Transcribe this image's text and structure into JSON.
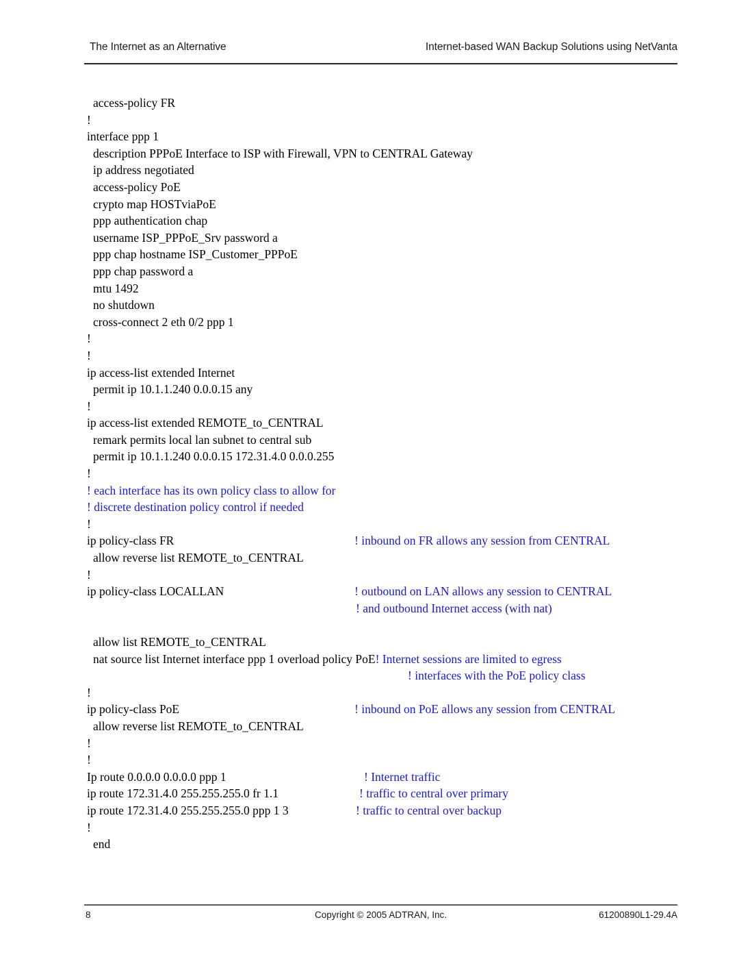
{
  "header": {
    "left": "The Internet as an Alternative",
    "right": "Internet-based WAN Backup Solutions using NetVanta"
  },
  "colors": {
    "comment_blue": "#1a1ad6",
    "text_black": "#000000",
    "rule_dark": "#262626",
    "rule_gray": "#5c5c5c"
  },
  "config": {
    "lines": [
      {
        "text": "access-policy FR"
      },
      {
        "text": "!"
      },
      {
        "text": "interface ppp 1"
      },
      {
        "text": "description PPPoE Interface to ISP with Firewall, VPN to CENTRAL Gateway"
      },
      {
        "text": "ip address negotiated"
      },
      {
        "text": "access-policy PoE"
      },
      {
        "text": "crypto map HOSTviaPoE"
      },
      {
        "text": "ppp authentication chap"
      },
      {
        "text": "username ISP_PPPoE_Srv password a"
      },
      {
        "text": "ppp chap hostname ISP_Customer_PPPoE"
      },
      {
        "text": "ppp chap password a"
      },
      {
        "text": "mtu 1492"
      },
      {
        "text": "no shutdown"
      },
      {
        "text": "cross-connect 2 eth 0/2 ppp 1"
      },
      {
        "text": "!"
      },
      {
        "text": "!"
      },
      {
        "text": "ip access-list extended Internet"
      },
      {
        "text": "permit ip 10.1.1.240 0.0.0.15 any"
      },
      {
        "text": "!"
      },
      {
        "text": "ip access-list extended REMOTE_to_CENTRAL"
      },
      {
        "text": "remark permits local lan subnet to central sub"
      },
      {
        "text": "permit ip 10.1.1.240 0.0.0.15  172.31.4.0 0.0.0.255"
      },
      {
        "text": "!"
      },
      {
        "text": "! each interface has its own policy class to allow for"
      },
      {
        "text": "! discrete destination policy control if needed"
      },
      {
        "text": "!"
      },
      {
        "text": "ip policy-class FR",
        "comment": "! inbound on FR allows any session from CENTRAL"
      },
      {
        "text": "allow reverse list REMOTE_to_CENTRAL"
      },
      {
        "text": "!"
      },
      {
        "text": "ip policy-class LOCALLAN",
        "comment": "! outbound on LAN allows any session to CENTRAL"
      },
      {
        "text": "",
        "comment": "! and outbound Internet access (with nat)"
      },
      {
        "text": ""
      },
      {
        "text": "allow list REMOTE_to_CENTRAL"
      },
      {
        "text": "nat source list Internet interface ppp 1 overload policy PoE",
        "inline_comment": "! Internet sessions are limited to egress"
      },
      {
        "text": "",
        "comment": "! interfaces with the PoE policy class"
      },
      {
        "text": "!"
      },
      {
        "text": "ip policy-class PoE",
        "comment": "! inbound on PoE allows any session from CENTRAL"
      },
      {
        "text": "allow reverse list REMOTE_to_CENTRAL"
      },
      {
        "text": "!"
      },
      {
        "text": "!"
      },
      {
        "text": "Ip route 0.0.0.0 0.0.0.0 ppp 1",
        "comment": "! Internet traffic"
      },
      {
        "text": "ip route 172.31.4.0 255.255.255.0 fr 1.1",
        "comment": "! traffic to central over primary"
      },
      {
        "text": "ip route 172.31.4.0 255.255.255.0 ppp 1 3",
        "comment": "! traffic to central over backup"
      },
      {
        "text": "!"
      },
      {
        "text": "end"
      }
    ]
  },
  "footer": {
    "page_number": "8",
    "copyright": "Copyright © 2005 ADTRAN, Inc.",
    "document_number": "61200890L1-29.4A"
  }
}
